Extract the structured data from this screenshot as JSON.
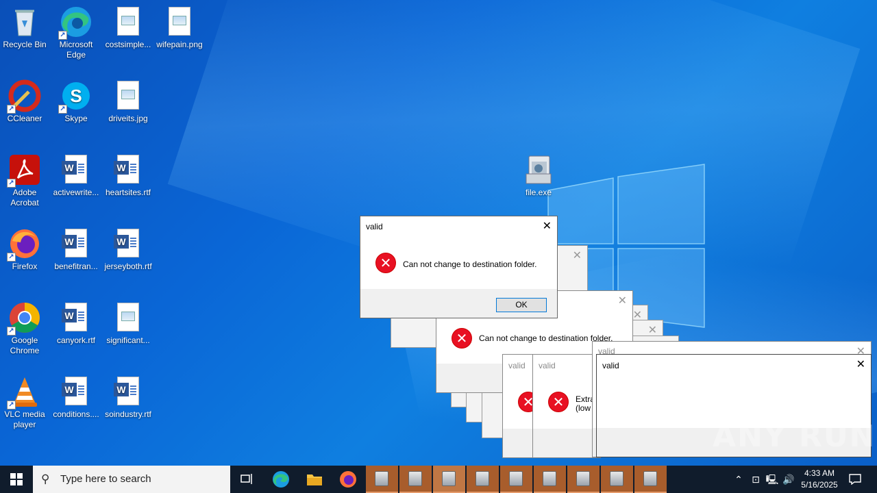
{
  "desktop": {
    "icons": [
      {
        "label": "Recycle Bin",
        "icon": "recycle-bin-icon"
      },
      {
        "label": "Microsoft Edge",
        "icon": "edge-icon"
      },
      {
        "label": "costsimple...",
        "icon": "image-file-icon"
      },
      {
        "label": "wifepain.png",
        "icon": "image-file-icon"
      },
      {
        "label": "CCleaner",
        "icon": "ccleaner-icon"
      },
      {
        "label": "Skype",
        "icon": "skype-icon"
      },
      {
        "label": "driveits.jpg",
        "icon": "image-file-icon"
      },
      {
        "label": "Adobe Acrobat",
        "icon": "acrobat-icon"
      },
      {
        "label": "activewrite...",
        "icon": "word-file-icon"
      },
      {
        "label": "heartsites.rtf",
        "icon": "word-file-icon"
      },
      {
        "label": "Firefox",
        "icon": "firefox-icon"
      },
      {
        "label": "benefitran...",
        "icon": "word-file-icon"
      },
      {
        "label": "jerseyboth.rtf",
        "icon": "word-file-icon"
      },
      {
        "label": "Google Chrome",
        "icon": "chrome-icon"
      },
      {
        "label": "canyork.rtf",
        "icon": "word-file-icon"
      },
      {
        "label": "significant...",
        "icon": "image-file-icon"
      },
      {
        "label": "VLC media player",
        "icon": "vlc-icon"
      },
      {
        "label": "conditions....",
        "icon": "word-file-icon"
      },
      {
        "label": "soindustry.rtf",
        "icon": "word-file-icon"
      },
      {
        "label": "file.exe",
        "icon": "installer-icon"
      }
    ]
  },
  "dialogs": {
    "front": {
      "title": "valid",
      "message": "Can not change to destination folder.",
      "ok": "OK"
    },
    "second": {
      "message": "Can not change to destination folder."
    },
    "small_a": {
      "title": "valid"
    },
    "small_b": {
      "title": "valid",
      "message_line1": "Extra",
      "message_line2": "(low"
    },
    "large_back": {
      "title": "valid"
    },
    "large_front": {
      "title": "valid"
    }
  },
  "watermark": "ANY RUN",
  "taskbar": {
    "search_placeholder": "Type here to search",
    "time": "4:33 AM",
    "date": "5/16/2025",
    "running_apps": 9
  }
}
